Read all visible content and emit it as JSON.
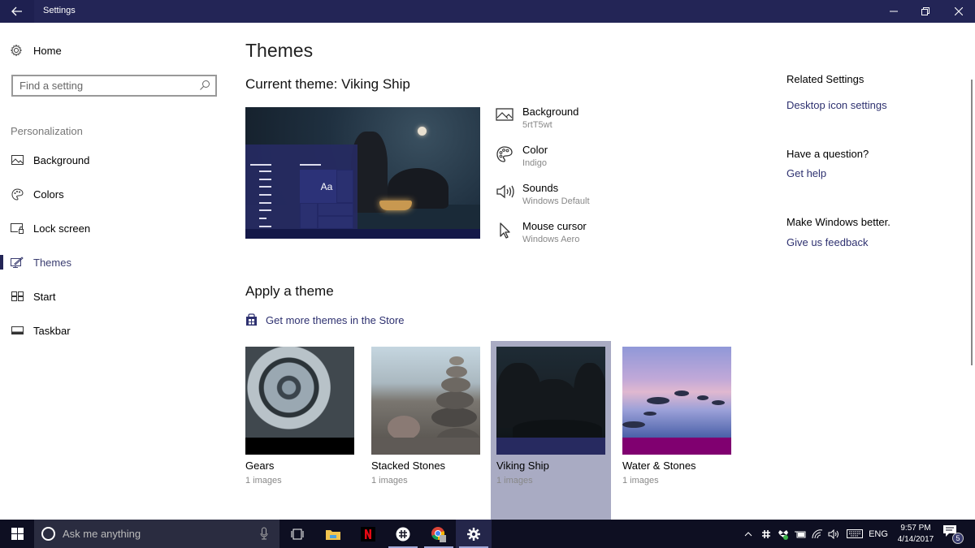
{
  "window": {
    "title": "Settings",
    "back_icon": "arrow-left-icon",
    "controls": [
      "minimize",
      "restore",
      "close"
    ]
  },
  "sidebar": {
    "home_label": "Home",
    "search_placeholder": "Find a setting",
    "section_label": "Personalization",
    "items": [
      {
        "label": "Background",
        "icon": "picture-icon",
        "active": false
      },
      {
        "label": "Colors",
        "icon": "palette-icon",
        "active": false
      },
      {
        "label": "Lock screen",
        "icon": "lock-screen-icon",
        "active": false
      },
      {
        "label": "Themes",
        "icon": "themes-icon",
        "active": true
      },
      {
        "label": "Start",
        "icon": "start-tiles-icon",
        "active": false
      },
      {
        "label": "Taskbar",
        "icon": "taskbar-icon",
        "active": false
      }
    ]
  },
  "main": {
    "page_title": "Themes",
    "current_theme_label": "Current theme: Viking Ship",
    "preview_tile_text": "Aa",
    "properties": [
      {
        "name": "Background",
        "value": "5rtT5wt",
        "icon": "picture-icon"
      },
      {
        "name": "Color",
        "value": "Indigo",
        "icon": "palette-icon"
      },
      {
        "name": "Sounds",
        "value": "Windows Default",
        "icon": "speaker-icon"
      },
      {
        "name": "Mouse cursor",
        "value": "Windows Aero",
        "icon": "cursor-icon"
      }
    ],
    "apply_title": "Apply a theme",
    "store_link": "Get more themes in the Store",
    "themes": [
      {
        "name": "Gears",
        "count": "1 images",
        "accent": "#000000",
        "selected": false
      },
      {
        "name": "Stacked Stones",
        "count": "1 images",
        "accent": "#5f5a56",
        "selected": false
      },
      {
        "name": "Viking Ship",
        "count": "1 images",
        "accent": "#272a60",
        "selected": true
      },
      {
        "name": "Water & Stones",
        "count": "1 images",
        "accent": "#800070",
        "selected": false
      }
    ]
  },
  "related": {
    "related_title": "Related Settings",
    "desktop_icon_link": "Desktop icon settings",
    "question_title": "Have a question?",
    "help_link": "Get help",
    "better_title": "Make Windows better.",
    "feedback_link": "Give us feedback"
  },
  "taskbar": {
    "search_placeholder": "Ask me anything",
    "apps": [
      "task-view",
      "file-explorer",
      "netflix",
      "slack",
      "chrome",
      "settings"
    ],
    "language": "ENG",
    "time": "9:57 PM",
    "date": "4/14/2017",
    "notification_count": "5"
  },
  "colors": {
    "accent": "#232556",
    "link": "#2e3170",
    "selected_tile": "#a9abc3"
  }
}
